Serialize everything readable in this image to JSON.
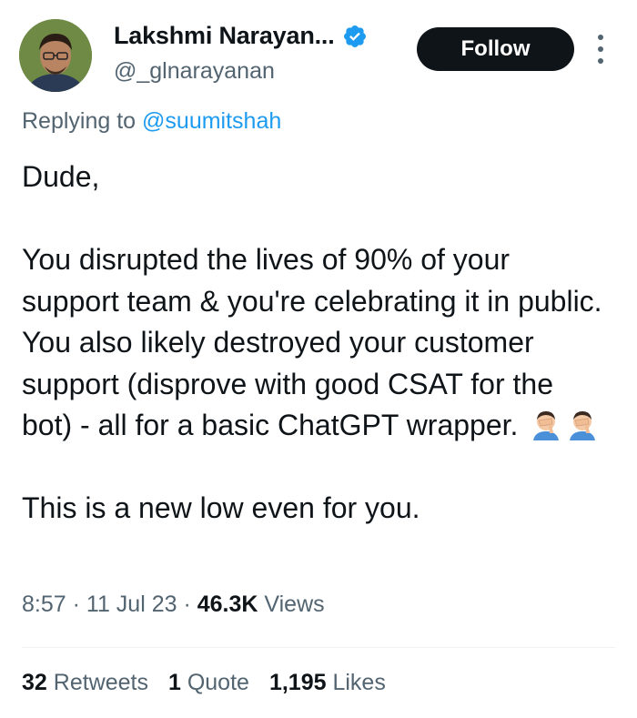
{
  "author": {
    "display_name": "Lakshmi Narayan...",
    "handle": "@_glnarayanan",
    "verified_icon": "verified-badge-icon",
    "avatar": "profile-photo"
  },
  "actions": {
    "follow_label": "Follow",
    "more_icon": "more-vertical-icon"
  },
  "reply": {
    "prefix": "Replying to ",
    "mention": "@suumitshah"
  },
  "tweet": {
    "text": "Dude,\n\nYou disrupted the lives of 90% of your support team & you're celebrating it in public. You also likely destroyed your customer support (disprove with good CSAT for the bot) - all for a basic ChatGPT wrapper.",
    "emojis": [
      "face-palm-icon",
      "face-palm-icon"
    ],
    "closing": "This is a new low even for you."
  },
  "meta": {
    "time": "8:57",
    "sep1": " · ",
    "date": "11 Jul 23",
    "sep2": " · ",
    "views_count": "46.3K",
    "views_label": " Views"
  },
  "stats": {
    "retweets_count": "32",
    "retweets_label": " Retweets",
    "quotes_count": "1",
    "quotes_label": " Quote",
    "likes_count": "1,195",
    "likes_label": " Likes"
  },
  "colors": {
    "text_primary": "#0f1419",
    "text_secondary": "#536471",
    "accent": "#1d9bf0",
    "button_bg": "#0f1419"
  }
}
